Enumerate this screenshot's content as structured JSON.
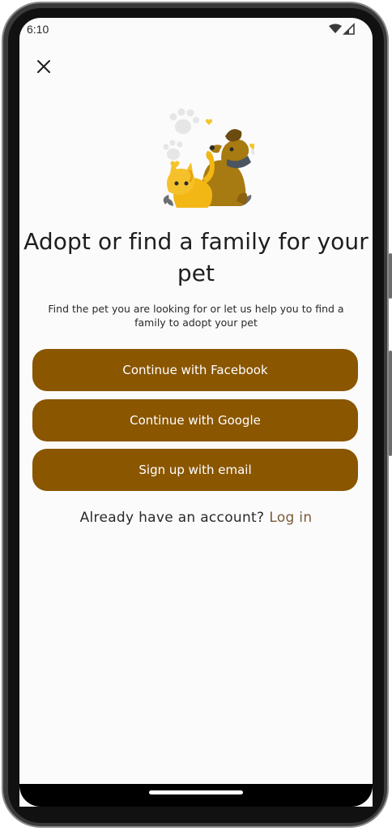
{
  "status_bar": {
    "time": "6:10",
    "icons": [
      "wifi-icon",
      "signal-icon"
    ]
  },
  "header": {
    "close_icon": "close-icon"
  },
  "hero": {
    "illustration": "dog-and-cat-illustration"
  },
  "content": {
    "title": "Adopt or find a family for your pet",
    "subtitle": "Find the pet you are looking for or let us help you to find a family to adopt your pet"
  },
  "actions": {
    "facebook_label": "Continue with Facebook",
    "google_label": "Continue with Google",
    "email_label": "Sign up with email"
  },
  "login": {
    "prompt": "Already have an account?",
    "link": "Log in"
  },
  "colors": {
    "accent": "#8a5600",
    "link": "#7a5a3a",
    "background": "#fbfbfb"
  }
}
